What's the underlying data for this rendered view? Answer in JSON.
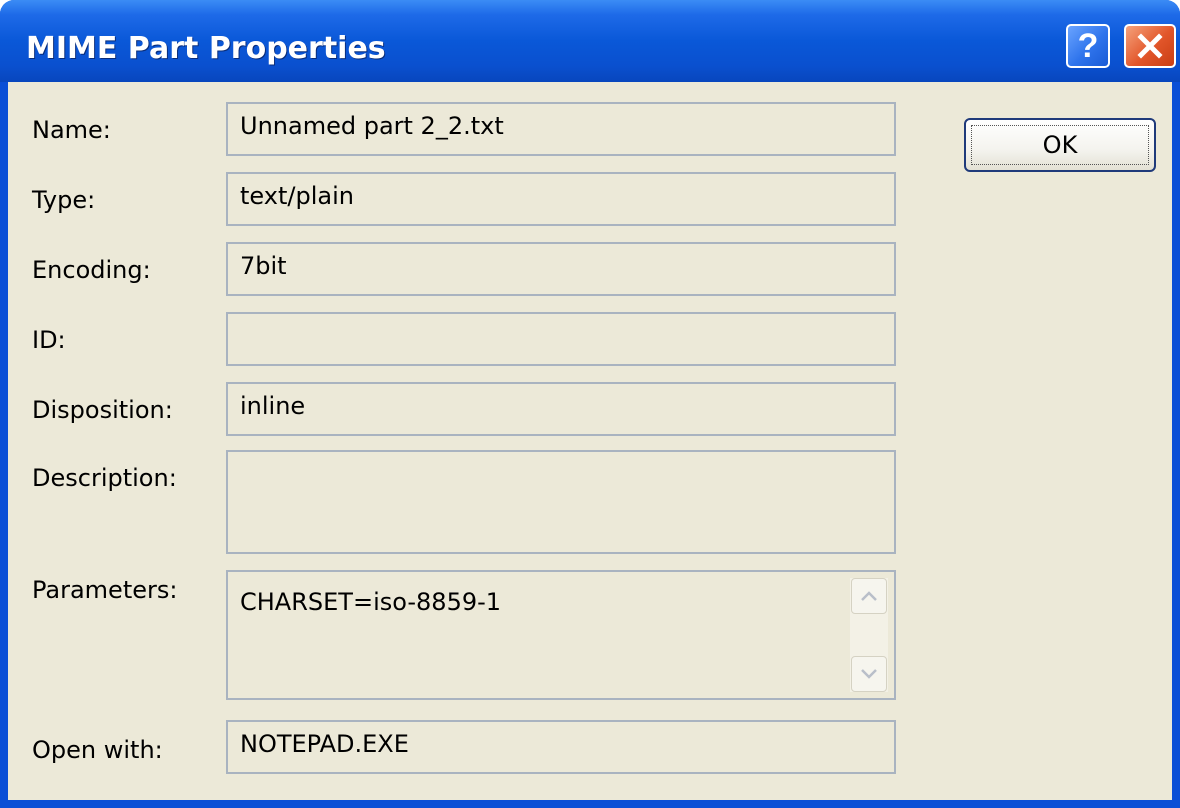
{
  "window": {
    "title": "MIME Part Properties",
    "help_label": "?",
    "close_label": "✕"
  },
  "fields": {
    "name": {
      "label": "Name:",
      "value": "Unnamed part 2_2.txt"
    },
    "type": {
      "label": "Type:",
      "value": "text/plain"
    },
    "encoding": {
      "label": "Encoding:",
      "value": "7bit"
    },
    "id": {
      "label": "ID:",
      "value": ""
    },
    "disposition": {
      "label": "Disposition:",
      "value": "inline"
    },
    "description": {
      "label": "Description:",
      "value": ""
    },
    "parameters": {
      "label": "Parameters:",
      "value": "CHARSET=iso-8859-1"
    },
    "open_with": {
      "label": "Open with:",
      "value": "NOTEPAD.EXE"
    }
  },
  "buttons": {
    "ok_label": "OK"
  },
  "icons": {
    "help": "help-icon",
    "close": "close-icon",
    "scroll_up": "chevron-up-icon",
    "scroll_down": "chevron-down-icon"
  },
  "colors": {
    "titlebar": "#0a58d8",
    "dialog_background": "#ece9d8",
    "close_button": "#e2562a"
  }
}
